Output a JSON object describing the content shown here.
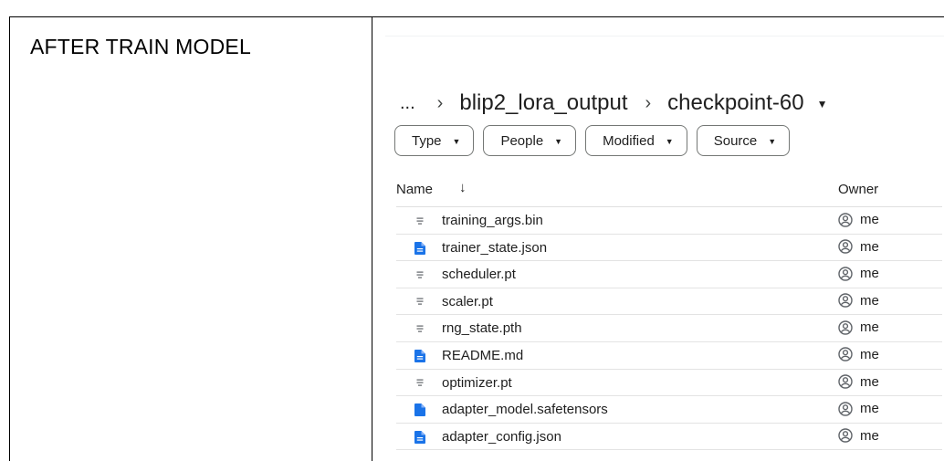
{
  "caption": "AFTER TRAIN MODEL",
  "breadcrumb": {
    "more": "...",
    "sep1": "›",
    "parent": "blip2_lora_output",
    "sep2": "›",
    "current": "checkpoint-60",
    "caret": "▼"
  },
  "filters": [
    {
      "label": "Type"
    },
    {
      "label": "People"
    },
    {
      "label": "Modified"
    },
    {
      "label": "Source"
    }
  ],
  "filter_caret": "▼",
  "columns": {
    "name": "Name",
    "sort_arrow": "↓",
    "owner": "Owner"
  },
  "files": [
    {
      "name": "training_args.bin",
      "icon": "generic-file-icon",
      "owner": "me"
    },
    {
      "name": "trainer_state.json",
      "icon": "doc-file-icon",
      "owner": "me"
    },
    {
      "name": "scheduler.pt",
      "icon": "generic-file-icon",
      "owner": "me"
    },
    {
      "name": "scaler.pt",
      "icon": "generic-file-icon",
      "owner": "me"
    },
    {
      "name": "rng_state.pth",
      "icon": "generic-file-icon",
      "owner": "me"
    },
    {
      "name": "README.md",
      "icon": "doc-file-icon",
      "owner": "me"
    },
    {
      "name": "optimizer.pt",
      "icon": "generic-file-icon",
      "owner": "me"
    },
    {
      "name": "adapter_model.safetensors",
      "icon": "blank-file-icon",
      "owner": "me"
    },
    {
      "name": "adapter_config.json",
      "icon": "doc-file-icon",
      "owner": "me"
    }
  ],
  "colors": {
    "file_blue": "#1a73e8",
    "generic_gray": "#5f6368",
    "avatar_gray": "#5f6368"
  }
}
